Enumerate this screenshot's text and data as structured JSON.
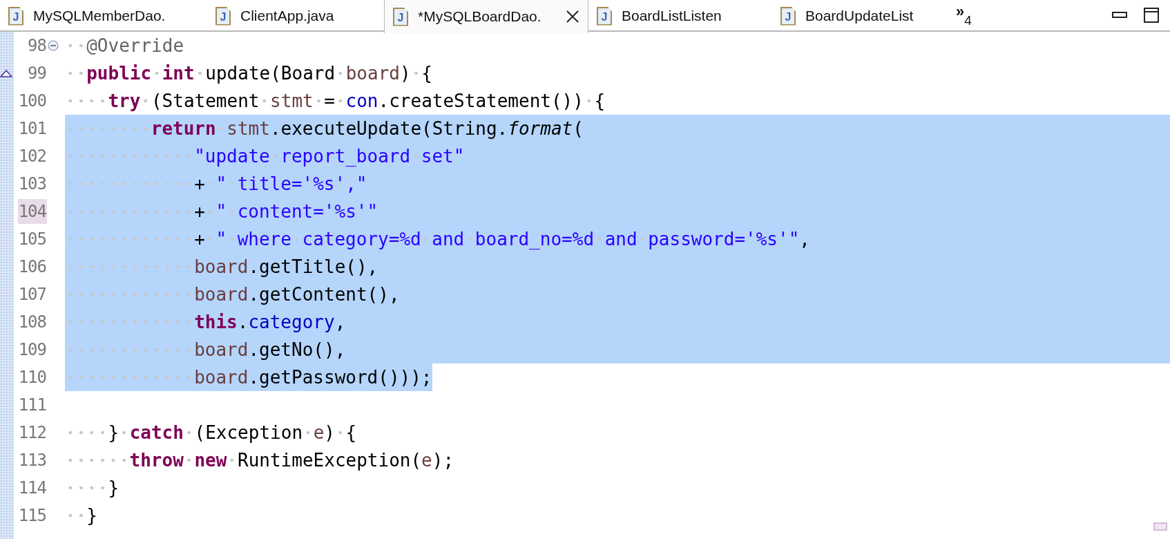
{
  "tabs": [
    {
      "label": "MySQLMemberDao.",
      "icon_letter": "J",
      "selected": false
    },
    {
      "label": "ClientApp.java",
      "icon_letter": "J",
      "selected": false
    },
    {
      "label": "*MySQLBoardDao.",
      "icon_letter": "J",
      "selected": true
    },
    {
      "label": "BoardListListen",
      "icon_letter": "J",
      "selected": false
    },
    {
      "label": "BoardUpdateList",
      "icon_letter": "J",
      "selected": false
    }
  ],
  "overflow": {
    "glyph": "»",
    "count": "4"
  },
  "lines": [
    {
      "number": "98",
      "fold_marker": true,
      "override_marker": false,
      "current": false,
      "in_selection": false,
      "tokens": [
        {
          "kind": "annotation",
          "text": "  @Override"
        }
      ]
    },
    {
      "number": "99",
      "fold_marker": false,
      "override_marker": true,
      "current": false,
      "in_selection": false,
      "tokens": [
        {
          "kind": "keyword",
          "text": "  public"
        },
        {
          "kind": "keyword",
          "text": " int"
        },
        {
          "kind": "plain",
          "text": " update(Board "
        },
        {
          "kind": "local",
          "text": "board"
        },
        {
          "kind": "plain",
          "text": ") {"
        }
      ]
    },
    {
      "number": "100",
      "fold_marker": false,
      "override_marker": false,
      "current": false,
      "in_selection": false,
      "tokens": [
        {
          "kind": "keyword",
          "text": "    try"
        },
        {
          "kind": "plain",
          "text": " (Statement "
        },
        {
          "kind": "local",
          "text": "stmt"
        },
        {
          "kind": "plain",
          "text": " = "
        },
        {
          "kind": "field",
          "text": "con"
        },
        {
          "kind": "plain",
          "text": ".createStatement()) {"
        }
      ]
    },
    {
      "number": "101",
      "fold_marker": false,
      "override_marker": false,
      "current": false,
      "in_selection": true,
      "selected_to_line_end": true,
      "tokens": [
        {
          "kind": "keyword",
          "text": "        return"
        },
        {
          "kind": "local",
          "text": " stmt"
        },
        {
          "kind": "plain",
          "text": ".executeUpdate(String."
        },
        {
          "kind": "static_method",
          "text": "format"
        },
        {
          "kind": "plain",
          "text": "("
        }
      ]
    },
    {
      "number": "102",
      "fold_marker": false,
      "override_marker": false,
      "current": false,
      "in_selection": true,
      "selected_to_line_end": true,
      "tokens": [
        {
          "kind": "string",
          "text": "            \"update report_board set\""
        }
      ]
    },
    {
      "number": "103",
      "fold_marker": false,
      "override_marker": false,
      "current": false,
      "in_selection": true,
      "selected_to_line_end": true,
      "tokens": [
        {
          "kind": "plain",
          "text": "            + "
        },
        {
          "kind": "string",
          "text": "\" title='%s',\""
        }
      ]
    },
    {
      "number": "104",
      "fold_marker": false,
      "override_marker": false,
      "current": true,
      "in_selection": true,
      "selected_to_line_end": true,
      "tokens": [
        {
          "kind": "plain",
          "text": "            + "
        },
        {
          "kind": "string",
          "text": "\" content='%s'\""
        }
      ]
    },
    {
      "number": "105",
      "fold_marker": false,
      "override_marker": false,
      "current": false,
      "in_selection": true,
      "selected_to_line_end": true,
      "tokens": [
        {
          "kind": "plain",
          "text": "            + "
        },
        {
          "kind": "string",
          "text": "\" where category=%d and board_no=%d and password='%s'\""
        },
        {
          "kind": "plain",
          "text": ","
        }
      ]
    },
    {
      "number": "106",
      "fold_marker": false,
      "override_marker": false,
      "current": false,
      "in_selection": true,
      "selected_to_line_end": true,
      "tokens": [
        {
          "kind": "local",
          "text": "            board"
        },
        {
          "kind": "plain",
          "text": ".getTitle(),"
        }
      ]
    },
    {
      "number": "107",
      "fold_marker": false,
      "override_marker": false,
      "current": false,
      "in_selection": true,
      "selected_to_line_end": true,
      "tokens": [
        {
          "kind": "local",
          "text": "            board"
        },
        {
          "kind": "plain",
          "text": ".getContent(),"
        }
      ]
    },
    {
      "number": "108",
      "fold_marker": false,
      "override_marker": false,
      "current": false,
      "in_selection": true,
      "selected_to_line_end": true,
      "tokens": [
        {
          "kind": "keyword",
          "text": "            this"
        },
        {
          "kind": "plain",
          "text": "."
        },
        {
          "kind": "field",
          "text": "category"
        },
        {
          "kind": "plain",
          "text": ","
        }
      ]
    },
    {
      "number": "109",
      "fold_marker": false,
      "override_marker": false,
      "current": false,
      "in_selection": true,
      "selected_to_line_end": true,
      "tokens": [
        {
          "kind": "local",
          "text": "            board"
        },
        {
          "kind": "plain",
          "text": ".getNo(),"
        }
      ]
    },
    {
      "number": "110",
      "fold_marker": false,
      "override_marker": false,
      "current": false,
      "in_selection": true,
      "selected_to_line_end": false,
      "tokens": [
        {
          "kind": "local",
          "text": "            board"
        },
        {
          "kind": "plain",
          "text": ".getPassword()));"
        }
      ]
    },
    {
      "number": "111",
      "fold_marker": false,
      "override_marker": false,
      "current": false,
      "in_selection": false
    },
    {
      "number": "112",
      "fold_marker": false,
      "override_marker": false,
      "current": false,
      "in_selection": false,
      "tokens": [
        {
          "kind": "plain",
          "text": "    } "
        },
        {
          "kind": "keyword",
          "text": "catch"
        },
        {
          "kind": "plain",
          "text": " (Exception "
        },
        {
          "kind": "local",
          "text": "e"
        },
        {
          "kind": "plain",
          "text": ") {"
        }
      ]
    },
    {
      "number": "113",
      "fold_marker": false,
      "override_marker": false,
      "current": false,
      "in_selection": false,
      "tokens": [
        {
          "kind": "keyword",
          "text": "      throw"
        },
        {
          "kind": "keyword",
          "text": " new"
        },
        {
          "kind": "plain",
          "text": " RuntimeException("
        },
        {
          "kind": "local",
          "text": "e"
        },
        {
          "kind": "plain",
          "text": ");"
        }
      ]
    },
    {
      "number": "114",
      "fold_marker": false,
      "override_marker": false,
      "current": false,
      "in_selection": false,
      "tokens": [
        {
          "kind": "plain",
          "text": "    }"
        }
      ]
    },
    {
      "number": "115",
      "fold_marker": false,
      "override_marker": false,
      "current": false,
      "in_selection": false,
      "tokens": [
        {
          "kind": "plain",
          "text": "  }"
        }
      ]
    }
  ]
}
